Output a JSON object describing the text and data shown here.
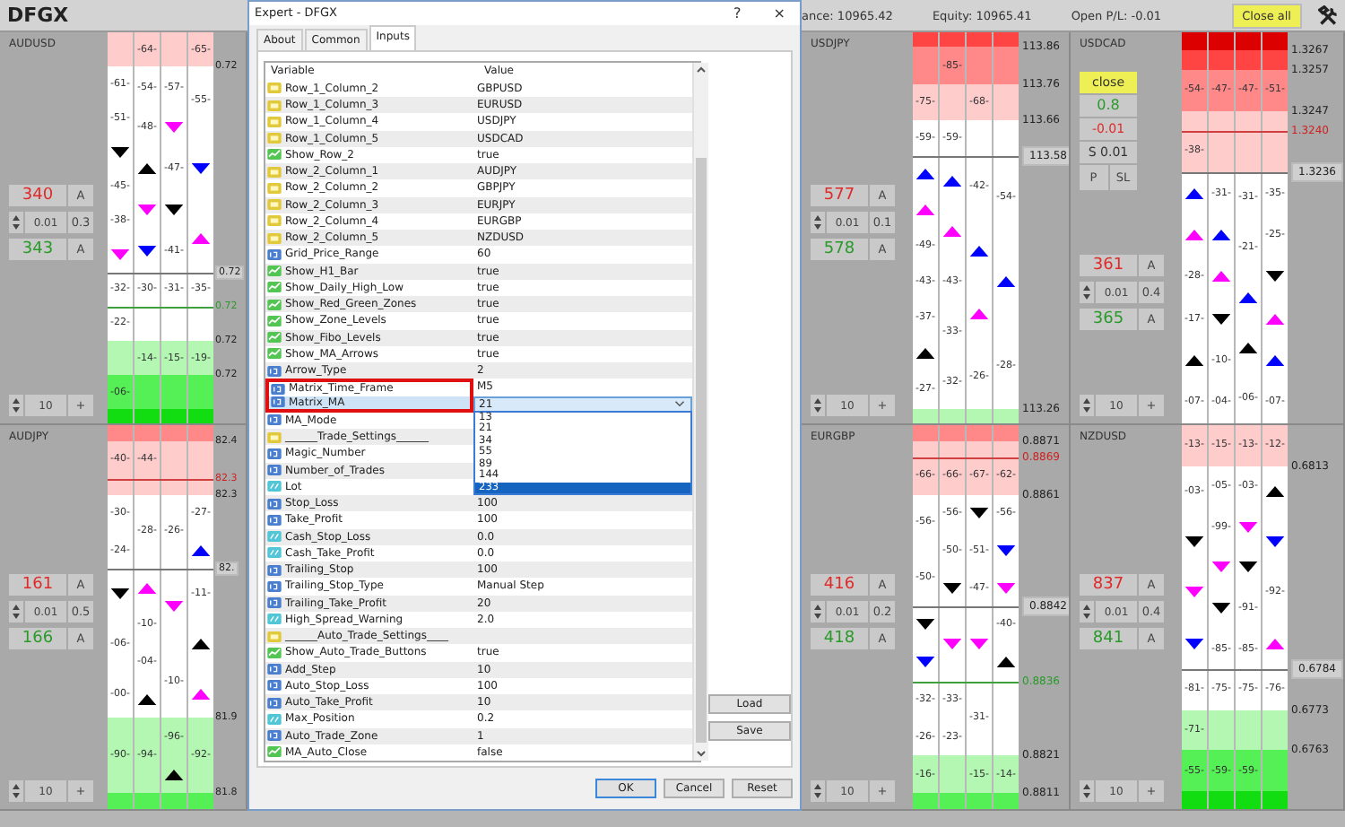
{
  "toolbar": {
    "title": "DFGX",
    "balance": "ance: 10965.42",
    "equity": "Equity: 10965.41",
    "open_pl": "Open P/L: -0.01",
    "close_all": "Close all"
  },
  "panels": [
    {
      "name": "AUDUSD",
      "controls": {
        "sell": "340",
        "sell_button": "A",
        "step": "0.01",
        "lot": "0.3",
        "buy": "343",
        "buy_button": "A",
        "amount": "10",
        "plus": "+"
      },
      "zones": [
        {
          "color": "#ffcccc",
          "cells": [
            [],
            [
              "-64-"
            ],
            [],
            [
              "-65-"
            ]
          ]
        },
        {
          "color": "#ffffff",
          "price": {
            "text": "0.72",
            "kind": "plain"
          },
          "cells": [
            [
              "-61-",
              "-51-",
              {
                "kind": "down",
                "color": "#000000"
              },
              "-45-",
              "-38-",
              {
                "kind": "down",
                "color": "#ff00ff"
              }
            ],
            [
              "-54-",
              "-48-",
              {
                "kind": "up",
                "color": "#000000"
              },
              {
                "kind": "down",
                "color": "#ff00ff"
              },
              {
                "kind": "down",
                "color": "#0000ff"
              }
            ],
            [
              "-57-",
              {
                "kind": "down",
                "color": "#ff00ff"
              },
              "-47-",
              {
                "kind": "down",
                "color": "#000000"
              },
              "-41-"
            ],
            [
              "-55-",
              {
                "kind": "down",
                "color": "#0000ff"
              },
              {
                "kind": "up",
                "color": "#ff00ff"
              }
            ]
          ]
        },
        {
          "color": "#ffffff",
          "price": {
            "text": "0.72",
            "kind": "current"
          },
          "cells": [
            [
              "-32-"
            ],
            [
              "-30-"
            ],
            [
              "-31-"
            ],
            [
              "-35-"
            ]
          ]
        },
        {
          "color": "#ffffff",
          "price": {
            "text": "0.72",
            "kind": "buy-line"
          },
          "cells": [
            [
              "-22-"
            ],
            [],
            [],
            []
          ]
        },
        {
          "color": "#b3f7b3",
          "price": {
            "text": "0.72",
            "kind": "plain"
          },
          "cells": [
            [],
            [
              "-14-"
            ],
            [
              "-15-"
            ],
            [
              "-19-"
            ]
          ]
        },
        {
          "color": "#55f055",
          "price": {
            "text": "0.72",
            "kind": "plain"
          },
          "cells": [
            [
              "-06-"
            ],
            [],
            [],
            []
          ]
        },
        {
          "color": "#11dd11",
          "cells": [
            [],
            [],
            [],
            []
          ]
        }
      ]
    },
    {
      "name": "USDJPY",
      "controls": {
        "sell": "577",
        "sell_button": "A",
        "step": "0.01",
        "lot": "0.1",
        "buy": "578",
        "buy_button": "A",
        "amount": "10",
        "plus": "+"
      },
      "zones": [
        {
          "color": "#ff4444",
          "cells": [
            [],
            [],
            [],
            []
          ]
        },
        {
          "color": "#ff8888",
          "price": {
            "text": "113.86",
            "kind": "plain"
          },
          "cells": [
            [],
            [
              "-85-"
            ],
            [],
            []
          ]
        },
        {
          "color": "#ffcccc",
          "price": {
            "text": "113.76",
            "kind": "plain"
          },
          "cells": [
            [
              "-75-"
            ],
            [],
            [
              "-68-"
            ],
            []
          ]
        },
        {
          "color": "#ffffff",
          "price": {
            "text": "113.66",
            "kind": "plain"
          },
          "cells": [
            [
              "-59-"
            ],
            [
              "-59-"
            ],
            [],
            []
          ]
        },
        {
          "color": "#ffffff",
          "price": {
            "text": "113.58",
            "kind": "current"
          },
          "cells": [
            [
              {
                "kind": "up",
                "color": "#0000ff"
              },
              {
                "kind": "up",
                "color": "#ff00ff"
              },
              "-49-",
              "-43-",
              "-37-",
              {
                "kind": "up",
                "color": "#000000"
              },
              "-27-"
            ],
            [
              {
                "kind": "up",
                "color": "#0000ff"
              },
              {
                "kind": "up",
                "color": "#ff00ff"
              },
              "-43-",
              "-33-",
              "-32-"
            ],
            [
              "-42-",
              {
                "kind": "up",
                "color": "#0000ff"
              },
              {
                "kind": "up",
                "color": "#ff00ff"
              },
              "-26-"
            ],
            [
              "-54-",
              {
                "kind": "up",
                "color": "#0000ff"
              },
              "-28-"
            ]
          ]
        },
        {
          "color": "#b3f7b3",
          "price": {
            "text": "113.26",
            "kind": "plain"
          },
          "cells": [
            [],
            [],
            [],
            []
          ]
        }
      ]
    },
    {
      "name": "USDCAD",
      "controls": {
        "sell": "361",
        "sell_button": "A",
        "step": "0.01",
        "lot": "0.4",
        "buy": "365",
        "buy_button": "A",
        "amount": "10",
        "plus": "+"
      },
      "position": {
        "close": "close",
        "profit": "0.8",
        "pips": "-0.01",
        "size": "S 0.01",
        "buttons": [
          "P",
          "SL"
        ]
      },
      "zones": [
        {
          "color": "#dd0000",
          "cells": [
            [],
            [],
            [],
            []
          ]
        },
        {
          "color": "#ff4444",
          "price": {
            "text": "1.3267",
            "kind": "plain"
          },
          "cells": [
            [],
            [],
            [],
            []
          ]
        },
        {
          "color": "#ff8888",
          "price": {
            "text": "1.3257",
            "kind": "plain"
          },
          "cells": [
            [
              "-54-"
            ],
            [
              "-47-"
            ],
            [
              "-47-"
            ],
            [
              "-51-"
            ]
          ]
        },
        {
          "color": "#ffcccc",
          "price": {
            "text": "1.3247",
            "kind": "plain"
          },
          "cells": [
            [],
            [],
            [],
            []
          ]
        },
        {
          "color": "#ffcccc",
          "price": {
            "text": "1.3240",
            "kind": "sell-line"
          },
          "cells": [
            [
              "-38-"
            ],
            [],
            [],
            []
          ]
        },
        {
          "color": "#ffffff",
          "price": {
            "text": "1.3236",
            "kind": "current"
          },
          "cells": [
            [
              {
                "kind": "up",
                "color": "#0000ff"
              },
              {
                "kind": "up",
                "color": "#ff00ff"
              },
              "-28-",
              "-17-",
              {
                "kind": "up",
                "color": "#000000"
              },
              "-07-"
            ],
            [
              "-31-",
              {
                "kind": "up",
                "color": "#0000ff"
              },
              {
                "kind": "up",
                "color": "#ff00ff"
              },
              {
                "kind": "down",
                "color": "#000000"
              },
              "-10-",
              "-04-"
            ],
            [
              "-31-",
              "-21-",
              {
                "kind": "up",
                "color": "#0000ff"
              },
              {
                "kind": "up",
                "color": "#000000"
              },
              "-06-"
            ],
            [
              "-35-",
              "-25-",
              {
                "kind": "down",
                "color": "#000000"
              },
              {
                "kind": "up",
                "color": "#ff00ff"
              },
              {
                "kind": "up",
                "color": "#0000ff"
              },
              "-07-"
            ]
          ]
        }
      ]
    },
    {
      "name": "AUDJPY",
      "controls": {
        "sell": "161",
        "sell_button": "A",
        "step": "0.01",
        "lot": "0.5",
        "buy": "166",
        "buy_button": "A",
        "amount": "10",
        "plus": "+"
      },
      "zones": [
        {
          "color": "#ff8888",
          "cells": [
            [],
            [],
            [],
            []
          ]
        },
        {
          "color": "#ffcccc",
          "price": {
            "text": "82.4",
            "kind": "plain"
          },
          "cells": [
            [
              "-40-"
            ],
            [
              "-44-"
            ],
            [],
            []
          ]
        },
        {
          "color": "#ffcccc",
          "price": {
            "text": "82.3",
            "kind": "sell-line"
          },
          "cells": [
            [],
            [],
            [],
            []
          ]
        },
        {
          "color": "#ffffff",
          "price": {
            "text": "82.3",
            "kind": "plain"
          },
          "cells": [
            [
              "-30-",
              "-24-"
            ],
            [
              "-28-"
            ],
            [
              "-26-"
            ],
            [
              "-27-",
              {
                "kind": "up",
                "color": "#0000ff"
              }
            ]
          ]
        },
        {
          "color": "#ffffff",
          "price": {
            "text": "82.",
            "kind": "current"
          },
          "cells": [
            [
              {
                "kind": "down",
                "color": "#000000"
              },
              "-06-",
              "-00-"
            ],
            [
              {
                "kind": "up",
                "color": "#ff00ff"
              },
              "-10-",
              "-04-",
              {
                "kind": "up",
                "color": "#000000"
              }
            ],
            [
              {
                "kind": "down",
                "color": "#ff00ff"
              },
              "-10-"
            ],
            [
              "-11-",
              {
                "kind": "up",
                "color": "#000000"
              },
              {
                "kind": "up",
                "color": "#ff00ff"
              }
            ]
          ]
        },
        {
          "color": "#b3f7b3",
          "price": {
            "text": "81.9",
            "kind": "plain"
          },
          "cells": [
            [
              "-90-"
            ],
            [
              "-94-"
            ],
            [
              "-96-",
              {
                "kind": "up",
                "color": "#000000"
              }
            ],
            [
              "-92-"
            ]
          ]
        },
        {
          "color": "#55f055",
          "price": {
            "text": "81.8",
            "kind": "plain"
          },
          "cells": [
            [],
            [],
            [],
            []
          ]
        }
      ]
    },
    {
      "name": "EURGBP",
      "controls": {
        "sell": "416",
        "sell_button": "A",
        "step": "0.01",
        "lot": "0.2",
        "buy": "418",
        "buy_button": "A",
        "amount": "10",
        "plus": "+"
      },
      "zones": [
        {
          "color": "#ff8888",
          "cells": [
            [],
            [],
            [],
            []
          ]
        },
        {
          "color": "#ffcccc",
          "price": {
            "text": "0.8871",
            "kind": "plain"
          },
          "cells": [
            [],
            [],
            [],
            []
          ]
        },
        {
          "color": "#ffcccc",
          "price": {
            "text": "0.8869",
            "kind": "sell-line"
          },
          "cells": [
            [
              "-66-"
            ],
            [
              "-66-"
            ],
            [
              "-67-"
            ],
            [
              "-62-"
            ]
          ]
        },
        {
          "color": "#ffffff",
          "price": {
            "text": "0.8861",
            "kind": "plain"
          },
          "cells": [
            [
              "-56-",
              "-50-"
            ],
            [
              "-56-",
              "-50-",
              {
                "kind": "down",
                "color": "#000000"
              }
            ],
            [
              {
                "kind": "down",
                "color": "#000000"
              },
              "-51-",
              "-47-"
            ],
            [
              "-56-",
              {
                "kind": "down",
                "color": "#0000ff"
              },
              {
                "kind": "down",
                "color": "#ff00ff"
              }
            ]
          ]
        },
        {
          "color": "#ffffff",
          "price": {
            "text": "0.8842",
            "kind": "current"
          },
          "cells": [
            [
              {
                "kind": "down",
                "color": "#000000"
              },
              {
                "kind": "down",
                "color": "#0000ff"
              }
            ],
            [
              {
                "kind": "down",
                "color": "#ff00ff"
              }
            ],
            [
              {
                "kind": "down",
                "color": "#ff00ff"
              }
            ],
            [
              "-40-",
              {
                "kind": "up",
                "color": "#000000"
              }
            ]
          ]
        },
        {
          "color": "#ffffff",
          "price": {
            "text": "0.8836",
            "kind": "buy-line"
          },
          "cells": [
            [
              "-32-",
              "-26-"
            ],
            [
              "-33-",
              "-23-"
            ],
            [
              "-31-"
            ],
            []
          ]
        },
        {
          "color": "#b3f7b3",
          "price": {
            "text": "0.8821",
            "kind": "plain"
          },
          "cells": [
            [
              "-16-"
            ],
            [],
            [
              "-15-"
            ],
            [
              "-14-"
            ]
          ]
        },
        {
          "color": "#55f055",
          "price": {
            "text": "0.8811",
            "kind": "plain"
          },
          "cells": [
            [],
            [],
            [],
            []
          ]
        }
      ]
    },
    {
      "name": "NZDUSD",
      "controls": {
        "sell": "837",
        "sell_button": "A",
        "step": "0.01",
        "lot": "0.4",
        "buy": "841",
        "buy_button": "A",
        "amount": "10",
        "plus": "+"
      },
      "zones": [
        {
          "color": "#ffcccc",
          "cells": [
            [
              "-13-"
            ],
            [
              "-15-"
            ],
            [
              "-13-"
            ],
            [
              "-12-"
            ]
          ]
        },
        {
          "color": "#ffffff",
          "price": {
            "text": "0.6813",
            "kind": "plain"
          },
          "cells": [
            [
              "-03-",
              {
                "kind": "down",
                "color": "#000000"
              },
              {
                "kind": "down",
                "color": "#ff00ff"
              },
              {
                "kind": "down",
                "color": "#0000ff"
              }
            ],
            [
              "-05-",
              "-99-",
              {
                "kind": "down",
                "color": "#ff00ff"
              },
              {
                "kind": "down",
                "color": "#000000"
              },
              "-85-"
            ],
            [
              "-03-",
              {
                "kind": "down",
                "color": "#ff00ff"
              },
              {
                "kind": "down",
                "color": "#000000"
              },
              "-91-",
              "-85-"
            ],
            [
              {
                "kind": "up",
                "color": "#000000"
              },
              {
                "kind": "down",
                "color": "#0000ff"
              },
              "-92-",
              {
                "kind": "up",
                "color": "#ff00ff"
              }
            ]
          ]
        },
        {
          "color": "#ffffff",
          "price": {
            "text": "0.6784",
            "kind": "current"
          },
          "cells": [
            [
              "-81-"
            ],
            [
              "-75-"
            ],
            [
              "-75-"
            ],
            [
              "-76-"
            ]
          ]
        },
        {
          "color": "#b3f7b3",
          "price": {
            "text": "0.6773",
            "kind": "plain"
          },
          "cells": [
            [
              "-71-"
            ],
            [],
            [],
            []
          ]
        },
        {
          "color": "#55f055",
          "price": {
            "text": "0.6763",
            "kind": "plain"
          },
          "cells": [
            [
              "-55-"
            ],
            [
              "-59-"
            ],
            [
              "-59-"
            ],
            []
          ]
        },
        {
          "color": "#11dd11",
          "cells": [
            [],
            [],
            [],
            []
          ]
        }
      ]
    }
  ],
  "dialog": {
    "title": "Expert - DFGX",
    "help": "?",
    "close": "×",
    "tabs": [
      {
        "label": "About",
        "selected": false
      },
      {
        "label": "Common",
        "selected": false
      },
      {
        "label": "Inputs",
        "selected": true
      }
    ],
    "columns": [
      "Variable",
      "Value"
    ],
    "rows": [
      {
        "kind": "string",
        "name": "Row_1_Column_2",
        "value": "GBPUSD",
        "selected": false,
        "outlined": false
      },
      {
        "kind": "string",
        "name": "Row_1_Column_3",
        "value": "EURUSD",
        "selected": false,
        "outlined": false
      },
      {
        "kind": "string",
        "name": "Row_1_Column_4",
        "value": "USDJPY",
        "selected": false,
        "outlined": false
      },
      {
        "kind": "string",
        "name": "Row_1_Column_5",
        "value": "USDCAD",
        "selected": false,
        "outlined": false
      },
      {
        "kind": "bool",
        "name": "Show_Row_2",
        "value": "true",
        "selected": false,
        "outlined": false
      },
      {
        "kind": "string",
        "name": "Row_2_Column_1",
        "value": "AUDJPY",
        "selected": false,
        "outlined": false
      },
      {
        "kind": "string",
        "name": "Row_2_Column_2",
        "value": "GBPJPY",
        "selected": false,
        "outlined": false
      },
      {
        "kind": "string",
        "name": "Row_2_Column_3",
        "value": "EURJPY",
        "selected": false,
        "outlined": false
      },
      {
        "kind": "string",
        "name": "Row_2_Column_4",
        "value": "EURGBP",
        "selected": false,
        "outlined": false
      },
      {
        "kind": "string",
        "name": "Row_2_Column_5",
        "value": "NZDUSD",
        "selected": false,
        "outlined": false
      },
      {
        "kind": "int",
        "name": "Grid_Price_Range",
        "value": "60",
        "selected": false,
        "outlined": false
      },
      {
        "kind": "bool",
        "name": "Show_H1_Bar",
        "value": "true",
        "selected": false,
        "outlined": false
      },
      {
        "kind": "bool",
        "name": "Show_Daily_High_Low",
        "value": "true",
        "selected": false,
        "outlined": false
      },
      {
        "kind": "bool",
        "name": "Show_Red_Green_Zones",
        "value": "true",
        "selected": false,
        "outlined": false
      },
      {
        "kind": "bool",
        "name": "Show_Zone_Levels",
        "value": "true",
        "selected": false,
        "outlined": false
      },
      {
        "kind": "bool",
        "name": "Show_Fibo_Levels",
        "value": "true",
        "selected": false,
        "outlined": false
      },
      {
        "kind": "bool",
        "name": "Show_MA_Arrows",
        "value": "true",
        "selected": false,
        "outlined": false
      },
      {
        "kind": "int",
        "name": "Arrow_Type",
        "value": "2",
        "selected": false,
        "outlined": false
      },
      {
        "kind": "int",
        "name": "Matrix_Time_Frame",
        "value": "M5",
        "selected": false,
        "outlined": true
      },
      {
        "kind": "int",
        "name": "Matrix_MA",
        "value": "21",
        "selected": true,
        "outlined": true,
        "dropdown": {
          "open": true,
          "options": [
            {
              "text": "13",
              "selected": false
            },
            {
              "text": "21",
              "selected": false
            },
            {
              "text": "34",
              "selected": false
            },
            {
              "text": "55",
              "selected": false
            },
            {
              "text": "89",
              "selected": false
            },
            {
              "text": "144",
              "selected": false
            },
            {
              "text": "233",
              "selected": true
            }
          ]
        }
      },
      {
        "kind": "int",
        "name": "MA_Mode",
        "selected": false,
        "outlined": false
      },
      {
        "kind": "string",
        "name": "______Trade_Settings______",
        "selected": false,
        "outlined": false
      },
      {
        "kind": "int",
        "name": "Magic_Number",
        "selected": false,
        "outlined": false
      },
      {
        "kind": "int",
        "name": "Number_of_Trades",
        "selected": false,
        "outlined": false
      },
      {
        "kind": "double",
        "name": "Lot",
        "selected": false,
        "outlined": false
      },
      {
        "kind": "int",
        "name": "Stop_Loss",
        "value": "100",
        "selected": false,
        "outlined": false
      },
      {
        "kind": "int",
        "name": "Take_Profit",
        "value": "100",
        "selected": false,
        "outlined": false
      },
      {
        "kind": "double",
        "name": "Cash_Stop_Loss",
        "value": "0.0",
        "selected": false,
        "outlined": false
      },
      {
        "kind": "double",
        "name": "Cash_Take_Profit",
        "value": "0.0",
        "selected": false,
        "outlined": false
      },
      {
        "kind": "int",
        "name": "Trailing_Stop",
        "value": "100",
        "selected": false,
        "outlined": false
      },
      {
        "kind": "int",
        "name": "Trailing_Stop_Type",
        "value": "Manual Step",
        "selected": false,
        "outlined": false
      },
      {
        "kind": "int",
        "name": "Trailing_Take_Profit",
        "value": "20",
        "selected": false,
        "outlined": false
      },
      {
        "kind": "double",
        "name": "High_Spread_Warning",
        "value": "2.0",
        "selected": false,
        "outlined": false
      },
      {
        "kind": "string",
        "name": "______Auto_Trade_Settings____",
        "selected": false,
        "outlined": false
      },
      {
        "kind": "bool",
        "name": "Show_Auto_Trade_Buttons",
        "value": "true",
        "selected": false,
        "outlined": false
      },
      {
        "kind": "int",
        "name": "Add_Step",
        "value": "10",
        "selected": false,
        "outlined": false
      },
      {
        "kind": "int",
        "name": "Auto_Stop_Loss",
        "value": "100",
        "selected": false,
        "outlined": false
      },
      {
        "kind": "int",
        "name": "Auto_Take_Profit",
        "value": "10",
        "selected": false,
        "outlined": false
      },
      {
        "kind": "double",
        "name": "Max_Position",
        "value": "0.2",
        "selected": false,
        "outlined": false
      },
      {
        "kind": "int",
        "name": "Auto_Trade_Zone",
        "value": "1",
        "selected": false,
        "outlined": false
      },
      {
        "kind": "bool",
        "name": "MA_Auto_Close",
        "value": "false",
        "selected": false,
        "outlined": false
      }
    ],
    "side_buttons": [
      "Load",
      "Save"
    ],
    "buttons": [
      {
        "label": "OK",
        "default": true
      },
      {
        "label": "Cancel",
        "default": false
      },
      {
        "label": "Reset",
        "default": false
      }
    ]
  }
}
